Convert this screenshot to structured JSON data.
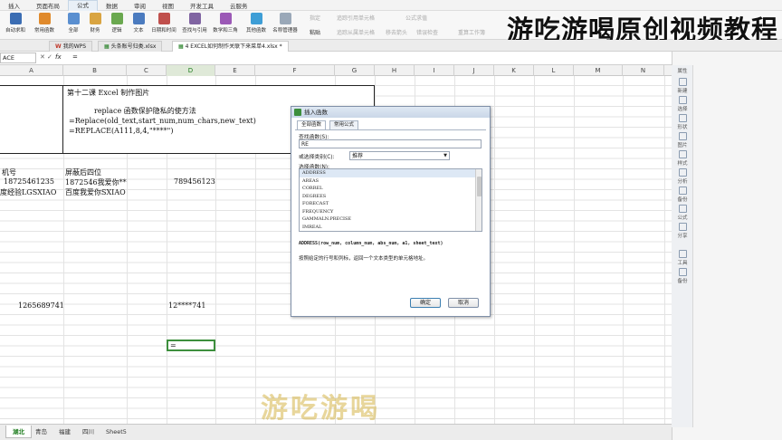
{
  "menu": [
    "插入",
    "页面布局",
    "公式",
    "数据",
    "审阅",
    "视图",
    "开发工具",
    "云服务"
  ],
  "ribbon": {
    "buttons": [
      "自动求和",
      "常用函数",
      "全部",
      "财务",
      "逻辑",
      "文本",
      "日期和时间",
      "查找与引用",
      "数学和三角",
      "其他函数",
      "名称管理器",
      "粘贴"
    ],
    "right_items": [
      "指定",
      "追踪引用单元格",
      "公式求值",
      "追踪从属单元格",
      "移去箭头",
      "错误检查",
      "重算工作簿"
    ]
  },
  "overlay_title": "游吃游喝原创视频教程",
  "doctabs": [
    "我的WPS",
    "头条账号归类.xlsx",
    "4 EXCEL如何制作关联下来菜单4.xlsx *"
  ],
  "formulabar": {
    "namebox": "ACE",
    "fx": "fx",
    "content": "="
  },
  "columns": [
    "A",
    "B",
    "C",
    "D",
    "E",
    "F",
    "G",
    "H",
    "I",
    "J",
    "K",
    "L",
    "M",
    "N"
  ],
  "cells": {
    "title": "第十二课    Excel 制作图片",
    "line1": "replace 函数保护隐私的使方法",
    "line2": "=Replace(old_text,start_num,num_chars,new_text)",
    "line3": "=REPLACE(A111,8,4,\"****\")",
    "a_header": "机号",
    "b_header": "屏蔽后四位",
    "a_row1": "18725461235",
    "b_row1": "1872546我爱你**",
    "a_row2": "度经验LGSXIAO",
    "b_row2": "百度我爱你SXIAO",
    "d_row1": "789456123",
    "a_row3": "1265689741",
    "d_row3": "12****741",
    "d_active": "="
  },
  "sidebar": [
    "属性",
    "新建",
    "选择",
    "形状",
    "图片",
    "样式",
    "分析",
    "备份",
    "公式",
    "分享",
    "工具",
    "备份"
  ],
  "sheets": [
    "湖北",
    "青岛",
    "福建",
    "四川",
    "Sheet5"
  ],
  "watermark": "游吃游喝",
  "dialog": {
    "title": "插入函数",
    "tabs": [
      "全部函数",
      "常用公式"
    ],
    "search_label": "查找函数(S):",
    "search_value": "RE",
    "category_label": "或选择类别(C):",
    "category_value": "推荐",
    "list_label": "选择函数(N):",
    "functions": [
      "ADDRESS",
      "AREAS",
      "CORREL",
      "DEGREES",
      "FORECAST",
      "FREQUENCY",
      "GAMMALN.PRECISE",
      "IMREAL"
    ],
    "signature": "ADDRESS(row_num, column_num, abs_num, a1, sheet_text)",
    "description": "按照给定的行号和列标，返回一个文本类型的单元格地址。",
    "ok": "确定",
    "cancel": "取消"
  },
  "colors": {
    "accent": "#1a7a1a",
    "selection": "#3d8f3d",
    "title_bar": "#c9d7e8"
  }
}
